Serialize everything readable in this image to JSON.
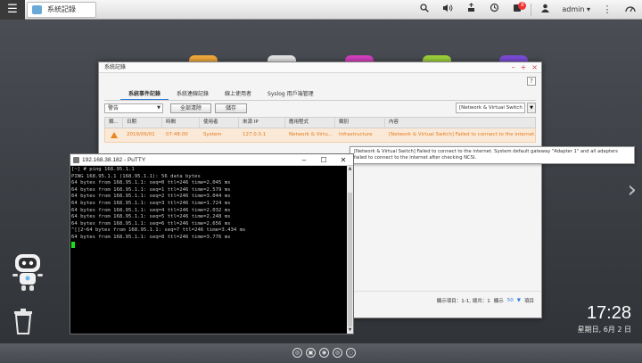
{
  "taskbar": {
    "menu_icon": "☰",
    "tab_label": "系統記錄",
    "user": "admin ▾",
    "notif_count": "8"
  },
  "window": {
    "title": "系統記錄",
    "tabs": [
      "系統事件記錄",
      "系統連線記錄",
      "線上使用者",
      "Syslog 用戶端管理"
    ],
    "severity_select": "警告",
    "clear_all": "全部清除",
    "save": "儲存",
    "filter": "[Network & Virtual Switch",
    "columns": [
      "類...",
      "日期",
      "時間",
      "使用者",
      "來源 IP",
      "應用程式",
      "類別",
      "內容"
    ],
    "row": {
      "date": "2019/06/01",
      "time": "07:48:00",
      "user": "System",
      "ip": "127.0.0.1",
      "app": "Network & Virtu...",
      "category": "Infrastructure",
      "content": "[Network & Virtual Switch] Failed to connect to the internet...."
    },
    "tooltip": "[Network & Virtual Switch] Failed to connect to the internet. System default gateway \"Adapter 1\" and all adapters failed to connect to the internet after checking NCSI.",
    "footer": {
      "display_label": "顯示項目：1-1, 總共：1",
      "display_count": "顯示",
      "per_page": "50",
      "unit": "項目"
    }
  },
  "putty": {
    "title": "192.168.38.182 - PuTTY",
    "lines": [
      "[~] # ping 168.95.1.1",
      "PING 168.95.1.1 (168.95.1.1): 56 data bytes",
      "64 bytes from 168.95.1.1: seq=0 ttl=246 time=2.045 ms",
      "64 bytes from 168.95.1.1: seq=1 ttl=246 time=2.579 ms",
      "64 bytes from 168.95.1.1: seq=2 ttl=246 time=3.044 ms",
      "64 bytes from 168.95.1.1: seq=3 ttl=246 time=1.724 ms",
      "64 bytes from 168.95.1.1: seq=4 ttl=246 time=2.032 ms",
      "64 bytes from 168.95.1.1: seq=5 ttl=246 time=2.248 ms",
      "64 bytes from 168.95.1.1: seq=6 ttl=246 time=2.656 ms",
      "^[[2~64 bytes from 168.95.1.1: seq=7 ttl=246 time=3.434 ms",
      "64 bytes from 168.95.1.1: seq=8 ttl=246 time=3.776 ms"
    ]
  },
  "desktop": {
    "clock": "17:28",
    "date": "星期日, 6月 2 日"
  },
  "colors": {
    "warning": "#e8871e",
    "accent": "#2b7ad6",
    "terminal_cursor": "#16e416"
  }
}
